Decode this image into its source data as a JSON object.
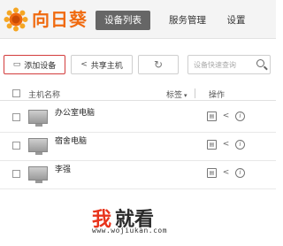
{
  "header": {
    "brand": "向日葵",
    "nav": [
      {
        "label": "设备列表",
        "active": true
      },
      {
        "label": "服务管理",
        "active": false
      },
      {
        "label": "设置",
        "active": false
      }
    ]
  },
  "toolbar": {
    "add_label": "添加设备",
    "share_label": "共享主机",
    "refresh_icon": "refresh-icon",
    "search_placeholder": "设备快速查询"
  },
  "table": {
    "columns": {
      "name": "主机名称",
      "tag": "标签",
      "ops": "操作"
    },
    "rows": [
      {
        "name": "办公室电脑"
      },
      {
        "name": "宿舍电脑"
      },
      {
        "name": "李强"
      }
    ]
  },
  "watermark": {
    "char1": "我",
    "rest": "就看",
    "url": "www.wojiukan.com"
  },
  "colors": {
    "brand": "#f06a0f",
    "active_tab_bg": "#666666",
    "add_button_border": "#d23c3c",
    "watermark_red": "#e8341c"
  }
}
